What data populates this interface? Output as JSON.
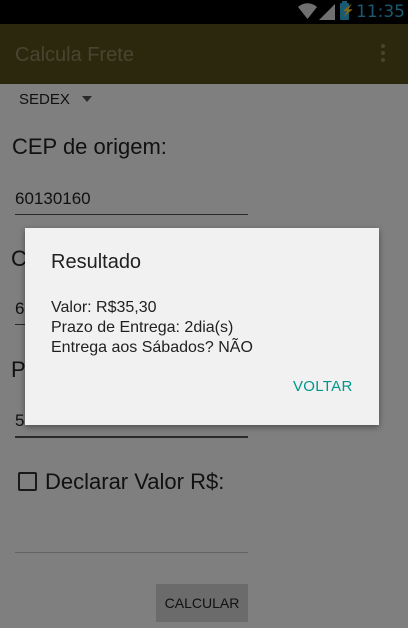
{
  "status_bar": {
    "time": "11:35"
  },
  "app_bar": {
    "title": "Calcula Frete"
  },
  "form": {
    "service_selected": "SEDEX",
    "origem_label": "CEP de origem:",
    "origem_value": "60130160",
    "destino_label_partial": "C",
    "destino_value_partial": "6",
    "peso_label_partial": "P",
    "peso_value_partial": "5",
    "declarar_label": "Declarar Valor R$:",
    "declarar_checked": false,
    "declarar_value": "",
    "calcular_label": "CALCULAR"
  },
  "dialog": {
    "title": "Resultado",
    "valor": "Valor: R$35,30",
    "prazo": "Prazo de Entrega: 2dia(s)",
    "sabados": "Entrega aos Sábados? NÃO",
    "button_label": "VOLTAR"
  },
  "colors": {
    "action_bar": "#59501a",
    "accent": "#00968a",
    "status_accent": "#33b5e5"
  }
}
